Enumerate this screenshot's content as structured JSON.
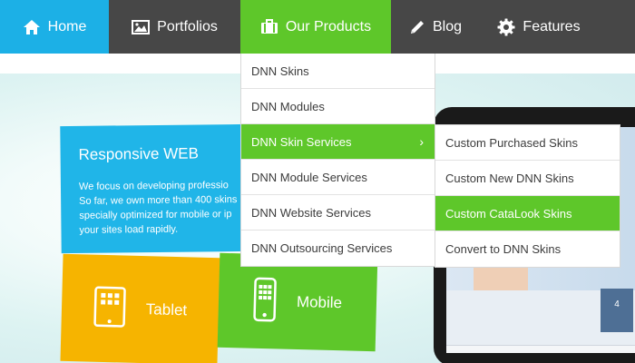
{
  "nav": {
    "items": [
      {
        "label": "Home",
        "icon": "home-icon",
        "color": "#1cb0e6"
      },
      {
        "label": "Portfolios",
        "icon": "image-icon",
        "color": "#474747"
      },
      {
        "label": "Our Products",
        "icon": "briefcase-icon",
        "color": "#5ec72a"
      },
      {
        "label": "Blog",
        "icon": "pencil-icon",
        "color": "#474747"
      },
      {
        "label": "Features",
        "icon": "gear-icon",
        "color": "#474747"
      }
    ]
  },
  "products_menu": {
    "items": [
      {
        "label": "DNN Skins"
      },
      {
        "label": "DNN Modules"
      },
      {
        "label": "DNN Skin Services",
        "active": true,
        "has_submenu": true
      },
      {
        "label": "DNN Module Services"
      },
      {
        "label": "DNN Website Services"
      },
      {
        "label": "DNN Outsourcing Services"
      }
    ],
    "submenu_arrow": "›"
  },
  "skin_services_submenu": {
    "items": [
      {
        "label": "Custom Purchased Skins"
      },
      {
        "label": "Custom New DNN Skins"
      },
      {
        "label": "Custom CataLook Skins",
        "active": true
      },
      {
        "label": "Convert to DNN Skins"
      }
    ]
  },
  "banner": {
    "web_tile": {
      "title": "Responsive WEB",
      "lines": [
        "We focus on developing professio",
        "So far, we own more than 400 skins",
        "specially optimized for mobile or ip",
        "your sites load rapidly."
      ]
    },
    "tablet_tile": {
      "label": "Tablet",
      "icon": "tablet-icon"
    },
    "mobile_tile": {
      "label": "Mobile",
      "icon": "mobile-icon"
    },
    "device_badge": "4"
  },
  "colors": {
    "nav_bg": "#474747",
    "accent_green": "#5ec72a",
    "accent_blue": "#1cb0e6",
    "tile_web": "#20b5e8",
    "tile_tablet": "#f6b400",
    "tile_mobile": "#5ec72a"
  }
}
